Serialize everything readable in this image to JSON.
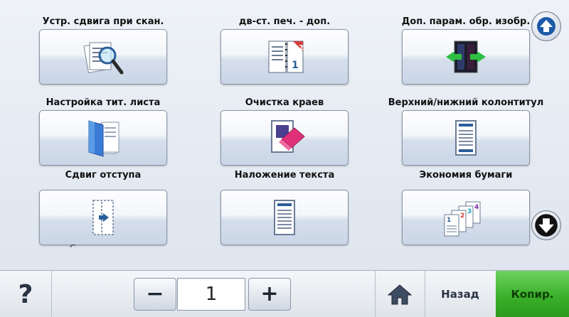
{
  "options": [
    {
      "label": "Устр. сдвига при скан.",
      "icon": "scan-skew-magnifier-icon"
    },
    {
      "label": "дв-ст. печ. - доп.",
      "icon": "duplex-pages-icon"
    },
    {
      "label": "Доп. парам. обр. изобр.",
      "icon": "advanced-imaging-icon"
    },
    {
      "label": "Настройка тит. листа",
      "icon": "cover-page-icon"
    },
    {
      "label": "Очистка краев",
      "icon": "edge-erase-icon"
    },
    {
      "label": "Верхний/нижний колонтитул",
      "icon": "header-footer-icon"
    },
    {
      "label": "Сдвиг отступа",
      "icon": "margin-shift-icon"
    },
    {
      "label": "Наложение текста",
      "icon": "overlay-text-icon"
    },
    {
      "label": "Экономия бумаги",
      "icon": "paper-saver-icon"
    }
  ],
  "partial_text": "С",
  "scroll": {
    "up_icon": "arrow-up-icon",
    "down_icon": "arrow-down-icon"
  },
  "bottom_bar": {
    "help_label": "?",
    "minus_label": "−",
    "quantity": "1",
    "plus_label": "+",
    "home_icon": "home-icon",
    "back_label": "Назад",
    "copy_label": "Копир."
  },
  "colors": {
    "copy_button": "#3ab02a",
    "accent_blue": "#3a7bd5"
  }
}
